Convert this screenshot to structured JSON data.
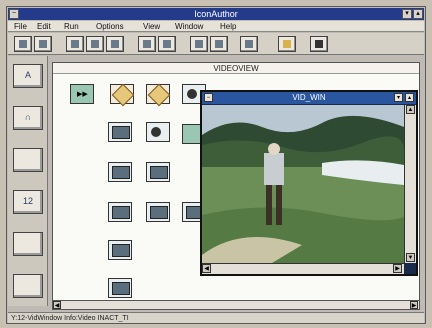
{
  "app": {
    "title": "IconAuthor"
  },
  "menu": [
    "File",
    "Edit",
    "Run",
    "Options",
    "View",
    "Window",
    "Help"
  ],
  "toolbar": {
    "icons": [
      "new-icon",
      "open-icon",
      "save-icon",
      "cut-icon",
      "copy-icon",
      "search-icon",
      "print-icon",
      "grid-icon",
      "layout-icon",
      "hand-icon",
      "trash-icon"
    ]
  },
  "palette": {
    "labels": [
      "A",
      "∩",
      "",
      "12",
      "",
      ""
    ]
  },
  "videoview": {
    "title": "VIDEOVIEW"
  },
  "vidwin": {
    "title": "VID_WIN"
  },
  "status": {
    "text": "Y:12-VidWindow Info:Video INACT_TI"
  },
  "colors": {
    "titlebar": "#243a8a",
    "vidwin_titlebar": "#2a56a0"
  }
}
